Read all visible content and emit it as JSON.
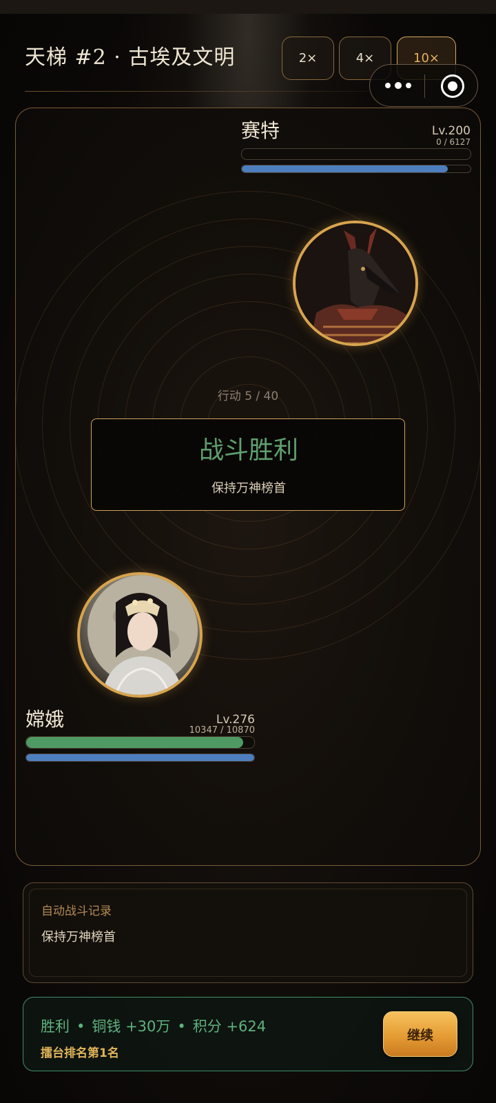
{
  "header": {
    "title": "天梯 #2 · 古埃及文明",
    "speed_buttons": [
      {
        "label": "2×",
        "active": false
      },
      {
        "label": "4×",
        "active": false
      },
      {
        "label": "10×",
        "active": true
      }
    ]
  },
  "enemy": {
    "name": "赛特",
    "level": "Lv.200",
    "hp_text": "0 / 6127",
    "hp_fraction": 0.0,
    "energy_fraction": 0.9
  },
  "battle": {
    "turn": "行动 5 / 40",
    "result_title": "战斗胜利",
    "result_subtitle": "保持万神榜首"
  },
  "player": {
    "name": "嫦娥",
    "level": "Lv.276",
    "hp_text": "10347 / 10870",
    "hp_fraction": 0.952,
    "energy_fraction": 1.0
  },
  "log": {
    "title": "自动战斗记录",
    "lines": [
      "保持万神榜首"
    ]
  },
  "reward": {
    "result": "胜利",
    "coins": "铜钱 +30万",
    "points": "积分 +624",
    "rank": "擂台排名第1名",
    "continue_label": "继续"
  },
  "colors": {
    "hp_green": "#4f9a64",
    "energy_blue": "#4d7fbe",
    "gold": "#d8a44e"
  }
}
